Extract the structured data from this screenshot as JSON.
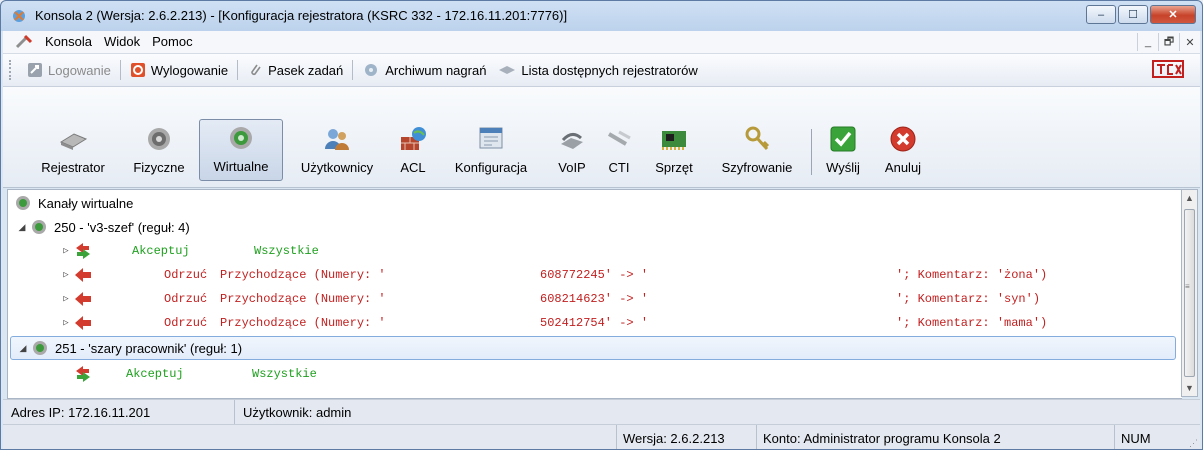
{
  "window": {
    "title": "Konsola 2 (Wersja:  2.6.2.213) - [Konfiguracja rejestratora (KSRC 332 - 172.16.11.201:7776)]",
    "buttons": {
      "minimize": "‒",
      "maximize": "☐",
      "close": "✕"
    }
  },
  "menu": {
    "items": [
      "Konsola",
      "Widok",
      "Pomoc"
    ],
    "mdi": {
      "minimize": "_",
      "restore": "🗗",
      "close": "✕"
    }
  },
  "quickbar": {
    "logowanie": "Logowanie",
    "wylogowanie": "Wylogowanie",
    "pasek": "Pasek zadań",
    "archiwum": "Archiwum nagrań",
    "lista": "Lista dostępnych rejestratorów"
  },
  "modules": {
    "rejestrator": "Rejestrator",
    "fizyczne": "Fizyczne",
    "wirtualne": "Wirtualne",
    "uzytkownicy": "Użytkownicy",
    "acl": "ACL",
    "konfiguracja": "Konfiguracja",
    "voip": "VoIP",
    "cti": "CTI",
    "sprzet": "Sprzęt",
    "szyfrowanie": "Szyfrowanie",
    "wyslij": "Wyślij",
    "anuluj": "Anuluj"
  },
  "tree": {
    "root": "Kanały wirtualne",
    "groups": [
      {
        "label": "250 - 'v3-szef' (reguł: 4)",
        "rules": [
          {
            "action": "Akceptuj",
            "dir": "Wszystkie",
            "num": "",
            "arrow": "",
            "comment": ""
          },
          {
            "action": "Odrzuć",
            "dir": "Przychodzące (Numery: '",
            "num": "608772245' -> '",
            "arrow": "",
            "comment": "'; Komentarz: 'żona')"
          },
          {
            "action": "Odrzuć",
            "dir": "Przychodzące (Numery: '",
            "num": "608214623' -> '",
            "arrow": "",
            "comment": "'; Komentarz: 'syn')"
          },
          {
            "action": "Odrzuć",
            "dir": "Przychodzące (Numery: '",
            "num": "502412754' -> '",
            "arrow": "",
            "comment": "'; Komentarz: 'mama')"
          }
        ]
      },
      {
        "label": "251 - 'szary pracownik' (reguł: 1)",
        "rules": [
          {
            "action": "Akceptuj",
            "dir": "Wszystkie"
          }
        ]
      }
    ]
  },
  "status": {
    "ip": "Adres IP: 172.16.11.201",
    "user": "Użytkownik: admin",
    "version": "Wersja: 2.6.2.213",
    "account": "Konto: Administrator programu Konsola 2",
    "num": "NUM"
  },
  "colors": {
    "accept": "#1ea01e",
    "reject": "#c21f1f",
    "selection": "#84acdd"
  }
}
